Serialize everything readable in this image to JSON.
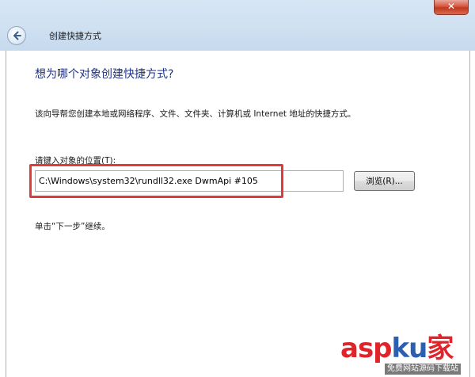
{
  "window": {
    "title": "创建快捷方式",
    "close_glyph": "✕"
  },
  "page": {
    "heading": "想为哪个对象创建快捷方式?",
    "description": "该向导帮您创建本地或网络程序、文件、文件夹、计算机或 Internet 地址的快捷方式。",
    "location_label": "请键入对象的位置(T):",
    "location_value": "C:\\Windows\\system32\\rundll32.exe DwmApi #105",
    "browse_label": "浏览(R)...",
    "continue_hint": "单击“下一步”继续。"
  },
  "watermark": {
    "logo_prefix": "asp",
    "logo_k": "ku",
    "logo_suffix": "家",
    "subtitle": "免费网站源码下载站"
  },
  "colors": {
    "heading": "#1e3287",
    "highlight": "#e23a3a",
    "titlebar": "#cfe0f1"
  },
  "icons": {
    "back": "back-arrow-icon",
    "close": "close-icon"
  }
}
